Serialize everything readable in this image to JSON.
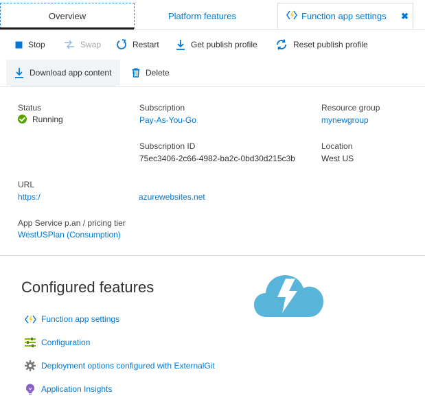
{
  "tabs": {
    "overview": "Overview",
    "platform": "Platform features",
    "function_app_settings": "Function app settings",
    "close_glyph": "✖"
  },
  "toolbar": {
    "stop": "Stop",
    "swap": "Swap",
    "restart": "Restart",
    "get_publish_profile": "Get publish profile",
    "reset_publish_profile": "Reset publish profile",
    "download_app_content": "Download app content",
    "delete": "Delete"
  },
  "essentials": {
    "status_label": "Status",
    "status_value": "Running",
    "subscription_label": "Subscription",
    "subscription_value": "Pay-As-You-Go",
    "resource_group_label": "Resource group",
    "resource_group_value": "mynewgroup",
    "subscription_id_label": "Subscription ID",
    "subscription_id_value": "75ec3406-2c66-4982-ba2c-0bd30d215c3b",
    "location_label": "Location",
    "location_value": "West US",
    "url_label": "URL",
    "url_value_start": "https:/",
    "url_value_end": "azurewebsites.net",
    "plan_label": "App Service p.an / pricing tier",
    "plan_value": "WestUSPlan (Consumption)"
  },
  "configured_features": {
    "title": "Configured features",
    "items": [
      {
        "label": "Function app settings",
        "icon": "lightning-icon"
      },
      {
        "label": "Configuration",
        "icon": "sliders-icon"
      },
      {
        "label": "Deployment options configured with ExternalGit",
        "icon": "gear-icon"
      },
      {
        "label": "Application Insights",
        "icon": "lightbulb-icon"
      }
    ]
  },
  "colors": {
    "accent": "#0078d4",
    "running": "#57a300",
    "cloud": "#59b4d9",
    "bolt": "#fcd116"
  }
}
